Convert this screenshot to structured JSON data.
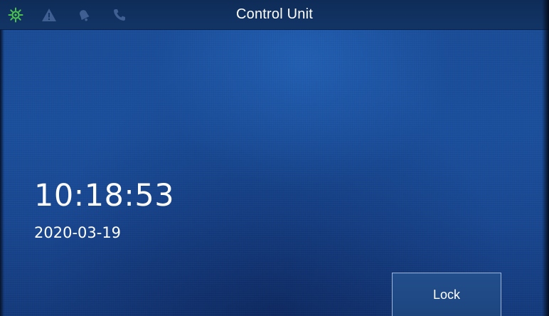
{
  "header": {
    "title": "Control Unit",
    "status_icons": [
      {
        "name": "sun-gear-icon",
        "color": "#4cc44c"
      },
      {
        "name": "warning-icon",
        "color": "#3f5f92"
      },
      {
        "name": "bell-icon",
        "color": "#3f5f92"
      },
      {
        "name": "phone-icon",
        "color": "#3f5f92"
      }
    ]
  },
  "main": {
    "time": "10:18:53",
    "date": "2020-03-19"
  },
  "actions": {
    "lock_label": "Lock"
  },
  "colors": {
    "background": "#1b4f9c",
    "header_bar": "#123566",
    "text": "#ffffff",
    "active_icon": "#4cc44c",
    "inactive_icon": "#3f5f92"
  }
}
